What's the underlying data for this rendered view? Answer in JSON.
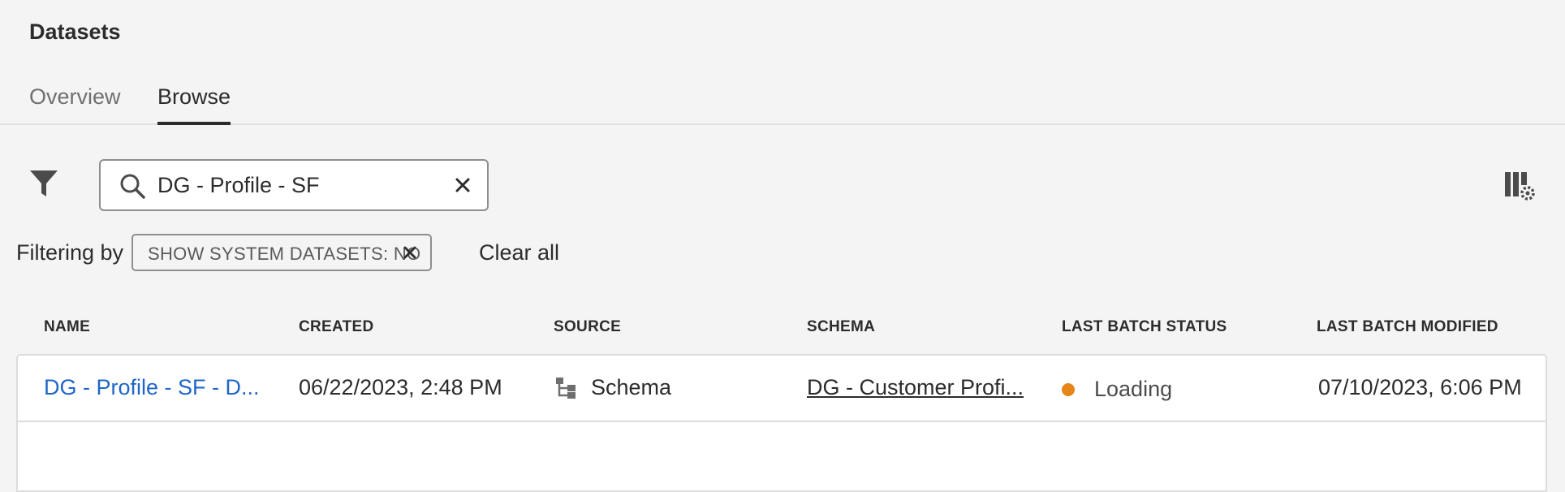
{
  "page": {
    "title": "Datasets"
  },
  "tabs": [
    {
      "label": "Overview",
      "active": false
    },
    {
      "label": "Browse",
      "active": true
    }
  ],
  "toolbar": {
    "filter_icon": "filter-icon",
    "search": {
      "value": "DG - Profile - SF",
      "icon": "search-icon",
      "clear_icon": "close-icon"
    },
    "settings_icon": "column-settings-icon"
  },
  "filters": {
    "label": "Filtering by",
    "chips": [
      {
        "text": "SHOW SYSTEM DATASETS: NO"
      }
    ],
    "clear_all": "Clear all"
  },
  "table": {
    "columns": [
      "NAME",
      "CREATED",
      "SOURCE",
      "SCHEMA",
      "LAST BATCH STATUS",
      "LAST BATCH MODIFIED"
    ],
    "rows": [
      {
        "name": "DG - Profile - SF - D...",
        "created": "06/22/2023, 2:48 PM",
        "source": "Schema",
        "schema": "DG - Customer Profi...",
        "status": "Loading",
        "status_color": "#e68619",
        "modified": "07/10/2023, 6:06 PM"
      }
    ]
  },
  "colors": {
    "link": "#1f66c8",
    "background": "#f4f4f4"
  }
}
